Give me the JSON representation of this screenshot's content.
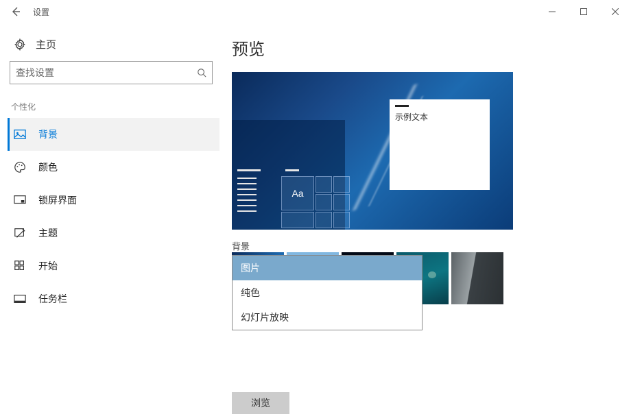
{
  "window": {
    "title": "设置"
  },
  "sidebar": {
    "home_label": "主页",
    "search_placeholder": "查找设置",
    "section_label": "个性化",
    "items": [
      {
        "label": "背景"
      },
      {
        "label": "颜色"
      },
      {
        "label": "锁屏界面"
      },
      {
        "label": "主题"
      },
      {
        "label": "开始"
      },
      {
        "label": "任务栏"
      }
    ]
  },
  "main": {
    "preview_heading": "预览",
    "sample_text": "示例文本",
    "tile_aa": "Aa",
    "bg_label": "背景",
    "dropdown": {
      "options": [
        {
          "label": "图片"
        },
        {
          "label": "纯色"
        },
        {
          "label": "幻灯片放映"
        }
      ],
      "selected_index": 0
    },
    "browse_label": "浏览"
  }
}
